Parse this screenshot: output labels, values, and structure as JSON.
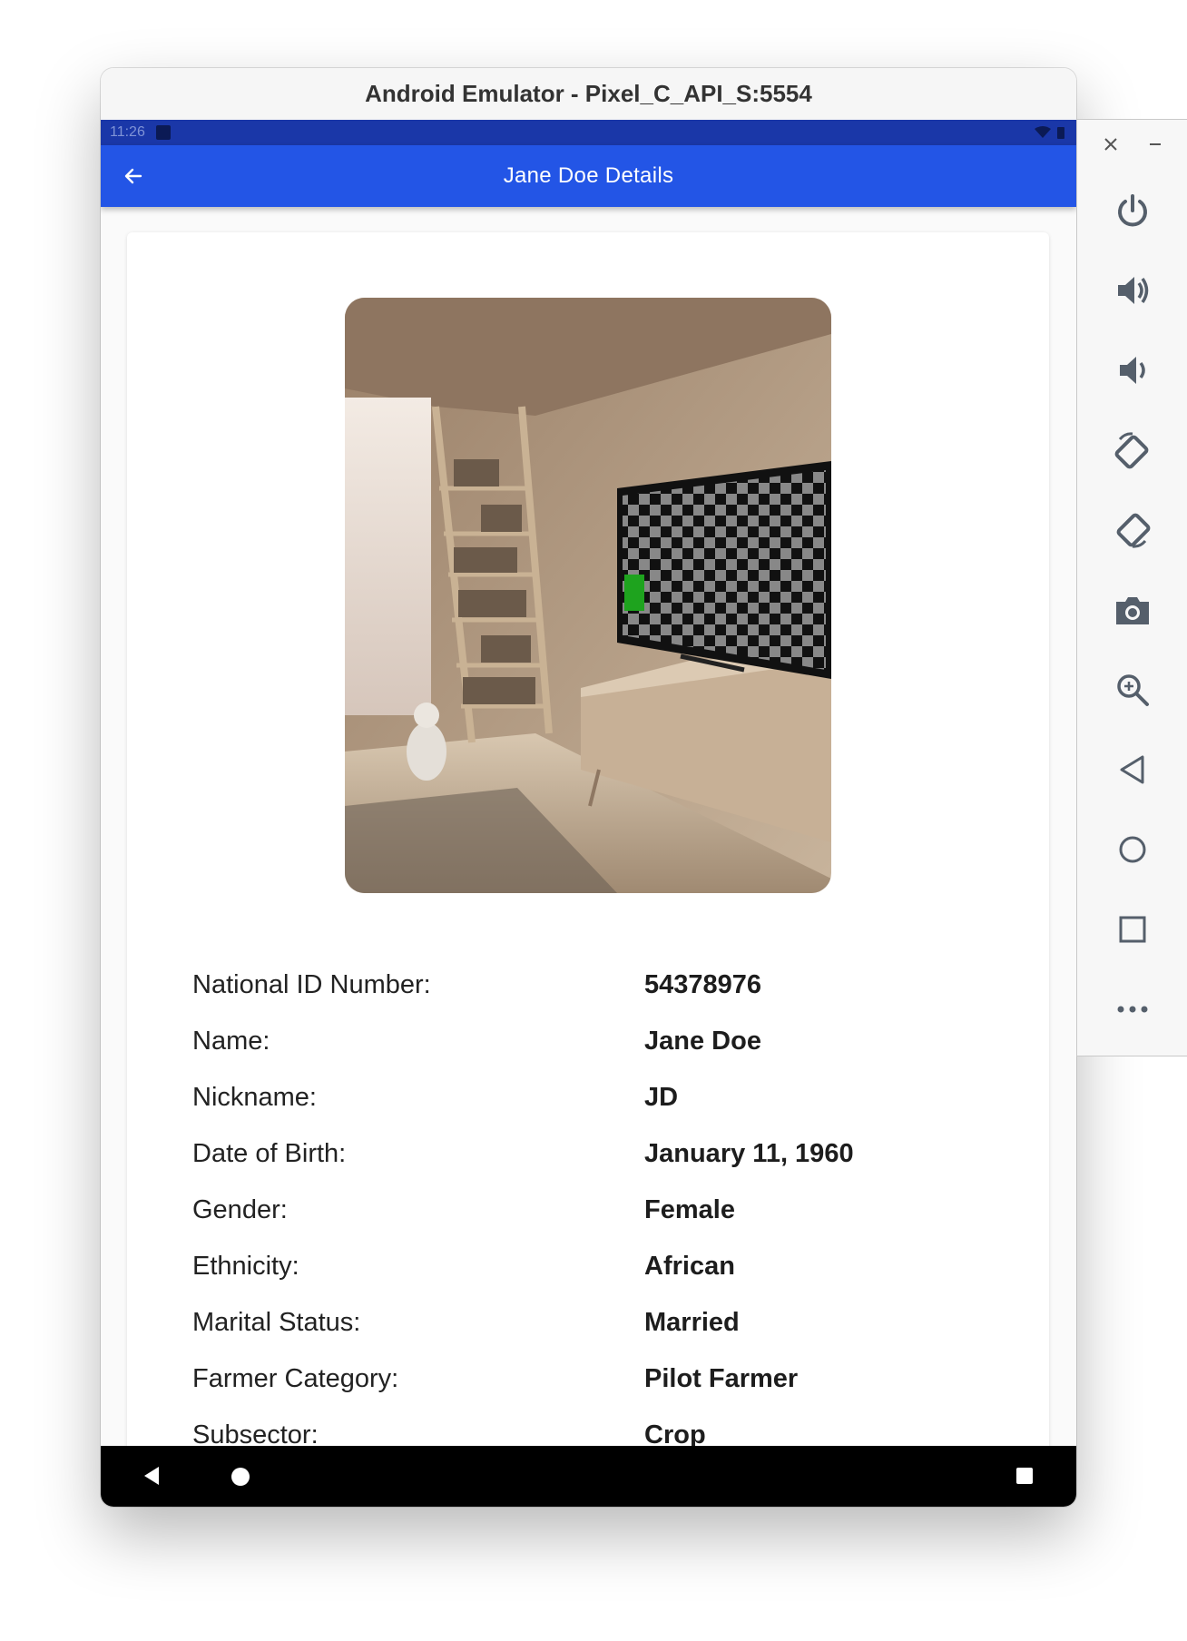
{
  "window": {
    "title": "Android Emulator - Pixel_C_API_S:5554"
  },
  "statusbar": {
    "time": "11:26"
  },
  "appbar": {
    "title": "Jane Doe Details"
  },
  "details": [
    {
      "label": "National ID Number:",
      "value": "54378976"
    },
    {
      "label": "Name:",
      "value": "Jane Doe"
    },
    {
      "label": "Nickname:",
      "value": "JD"
    },
    {
      "label": "Date of Birth:",
      "value": "January 11, 1960"
    },
    {
      "label": "Gender:",
      "value": "Female"
    },
    {
      "label": "Ethnicity:",
      "value": "African"
    },
    {
      "label": "Marital Status:",
      "value": "Married"
    },
    {
      "label": "Farmer Category:",
      "value": "Pilot Farmer"
    },
    {
      "label": "Subsector:",
      "value": "Crop"
    }
  ],
  "sidebar": {
    "icons": [
      "close-icon",
      "minimize-icon",
      "power-icon",
      "volume-up-icon",
      "volume-down-icon",
      "rotate-left-icon",
      "rotate-right-icon",
      "camera-icon",
      "zoom-icon",
      "back-icon",
      "home-icon",
      "overview-icon",
      "more-icon"
    ]
  },
  "colors": {
    "appbar": "#2355e6",
    "statusbar": "#1a37a8",
    "navbar": "#000000"
  }
}
